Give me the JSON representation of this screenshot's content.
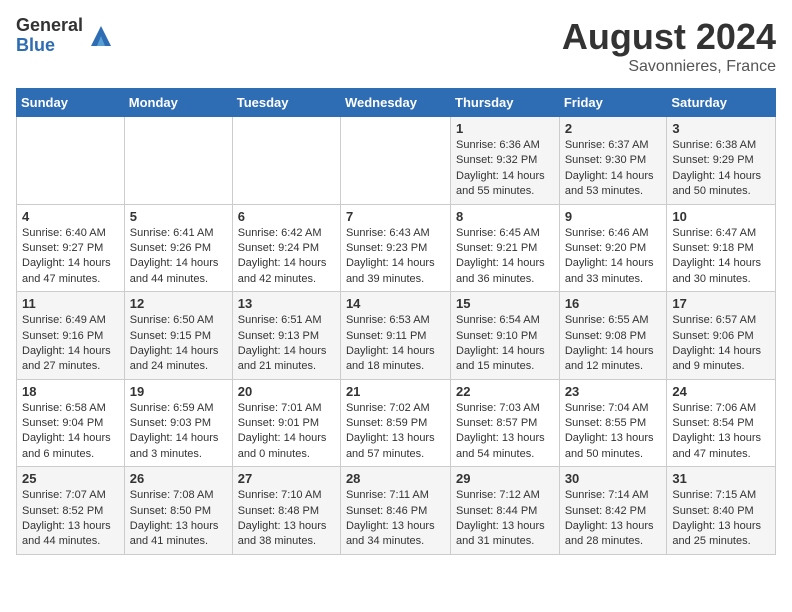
{
  "header": {
    "logo_general": "General",
    "logo_blue": "Blue",
    "month_year": "August 2024",
    "location": "Savonnieres, France"
  },
  "calendar": {
    "days_of_week": [
      "Sunday",
      "Monday",
      "Tuesday",
      "Wednesday",
      "Thursday",
      "Friday",
      "Saturday"
    ],
    "weeks": [
      [
        {
          "day": "",
          "info": ""
        },
        {
          "day": "",
          "info": ""
        },
        {
          "day": "",
          "info": ""
        },
        {
          "day": "",
          "info": ""
        },
        {
          "day": "1",
          "info": "Sunrise: 6:36 AM\nSunset: 9:32 PM\nDaylight: 14 hours and 55 minutes."
        },
        {
          "day": "2",
          "info": "Sunrise: 6:37 AM\nSunset: 9:30 PM\nDaylight: 14 hours and 53 minutes."
        },
        {
          "day": "3",
          "info": "Sunrise: 6:38 AM\nSunset: 9:29 PM\nDaylight: 14 hours and 50 minutes."
        }
      ],
      [
        {
          "day": "4",
          "info": "Sunrise: 6:40 AM\nSunset: 9:27 PM\nDaylight: 14 hours and 47 minutes."
        },
        {
          "day": "5",
          "info": "Sunrise: 6:41 AM\nSunset: 9:26 PM\nDaylight: 14 hours and 44 minutes."
        },
        {
          "day": "6",
          "info": "Sunrise: 6:42 AM\nSunset: 9:24 PM\nDaylight: 14 hours and 42 minutes."
        },
        {
          "day": "7",
          "info": "Sunrise: 6:43 AM\nSunset: 9:23 PM\nDaylight: 14 hours and 39 minutes."
        },
        {
          "day": "8",
          "info": "Sunrise: 6:45 AM\nSunset: 9:21 PM\nDaylight: 14 hours and 36 minutes."
        },
        {
          "day": "9",
          "info": "Sunrise: 6:46 AM\nSunset: 9:20 PM\nDaylight: 14 hours and 33 minutes."
        },
        {
          "day": "10",
          "info": "Sunrise: 6:47 AM\nSunset: 9:18 PM\nDaylight: 14 hours and 30 minutes."
        }
      ],
      [
        {
          "day": "11",
          "info": "Sunrise: 6:49 AM\nSunset: 9:16 PM\nDaylight: 14 hours and 27 minutes."
        },
        {
          "day": "12",
          "info": "Sunrise: 6:50 AM\nSunset: 9:15 PM\nDaylight: 14 hours and 24 minutes."
        },
        {
          "day": "13",
          "info": "Sunrise: 6:51 AM\nSunset: 9:13 PM\nDaylight: 14 hours and 21 minutes."
        },
        {
          "day": "14",
          "info": "Sunrise: 6:53 AM\nSunset: 9:11 PM\nDaylight: 14 hours and 18 minutes."
        },
        {
          "day": "15",
          "info": "Sunrise: 6:54 AM\nSunset: 9:10 PM\nDaylight: 14 hours and 15 minutes."
        },
        {
          "day": "16",
          "info": "Sunrise: 6:55 AM\nSunset: 9:08 PM\nDaylight: 14 hours and 12 minutes."
        },
        {
          "day": "17",
          "info": "Sunrise: 6:57 AM\nSunset: 9:06 PM\nDaylight: 14 hours and 9 minutes."
        }
      ],
      [
        {
          "day": "18",
          "info": "Sunrise: 6:58 AM\nSunset: 9:04 PM\nDaylight: 14 hours and 6 minutes."
        },
        {
          "day": "19",
          "info": "Sunrise: 6:59 AM\nSunset: 9:03 PM\nDaylight: 14 hours and 3 minutes."
        },
        {
          "day": "20",
          "info": "Sunrise: 7:01 AM\nSunset: 9:01 PM\nDaylight: 14 hours and 0 minutes."
        },
        {
          "day": "21",
          "info": "Sunrise: 7:02 AM\nSunset: 8:59 PM\nDaylight: 13 hours and 57 minutes."
        },
        {
          "day": "22",
          "info": "Sunrise: 7:03 AM\nSunset: 8:57 PM\nDaylight: 13 hours and 54 minutes."
        },
        {
          "day": "23",
          "info": "Sunrise: 7:04 AM\nSunset: 8:55 PM\nDaylight: 13 hours and 50 minutes."
        },
        {
          "day": "24",
          "info": "Sunrise: 7:06 AM\nSunset: 8:54 PM\nDaylight: 13 hours and 47 minutes."
        }
      ],
      [
        {
          "day": "25",
          "info": "Sunrise: 7:07 AM\nSunset: 8:52 PM\nDaylight: 13 hours and 44 minutes."
        },
        {
          "day": "26",
          "info": "Sunrise: 7:08 AM\nSunset: 8:50 PM\nDaylight: 13 hours and 41 minutes."
        },
        {
          "day": "27",
          "info": "Sunrise: 7:10 AM\nSunset: 8:48 PM\nDaylight: 13 hours and 38 minutes."
        },
        {
          "day": "28",
          "info": "Sunrise: 7:11 AM\nSunset: 8:46 PM\nDaylight: 13 hours and 34 minutes."
        },
        {
          "day": "29",
          "info": "Sunrise: 7:12 AM\nSunset: 8:44 PM\nDaylight: 13 hours and 31 minutes."
        },
        {
          "day": "30",
          "info": "Sunrise: 7:14 AM\nSunset: 8:42 PM\nDaylight: 13 hours and 28 minutes."
        },
        {
          "day": "31",
          "info": "Sunrise: 7:15 AM\nSunset: 8:40 PM\nDaylight: 13 hours and 25 minutes."
        }
      ]
    ]
  }
}
